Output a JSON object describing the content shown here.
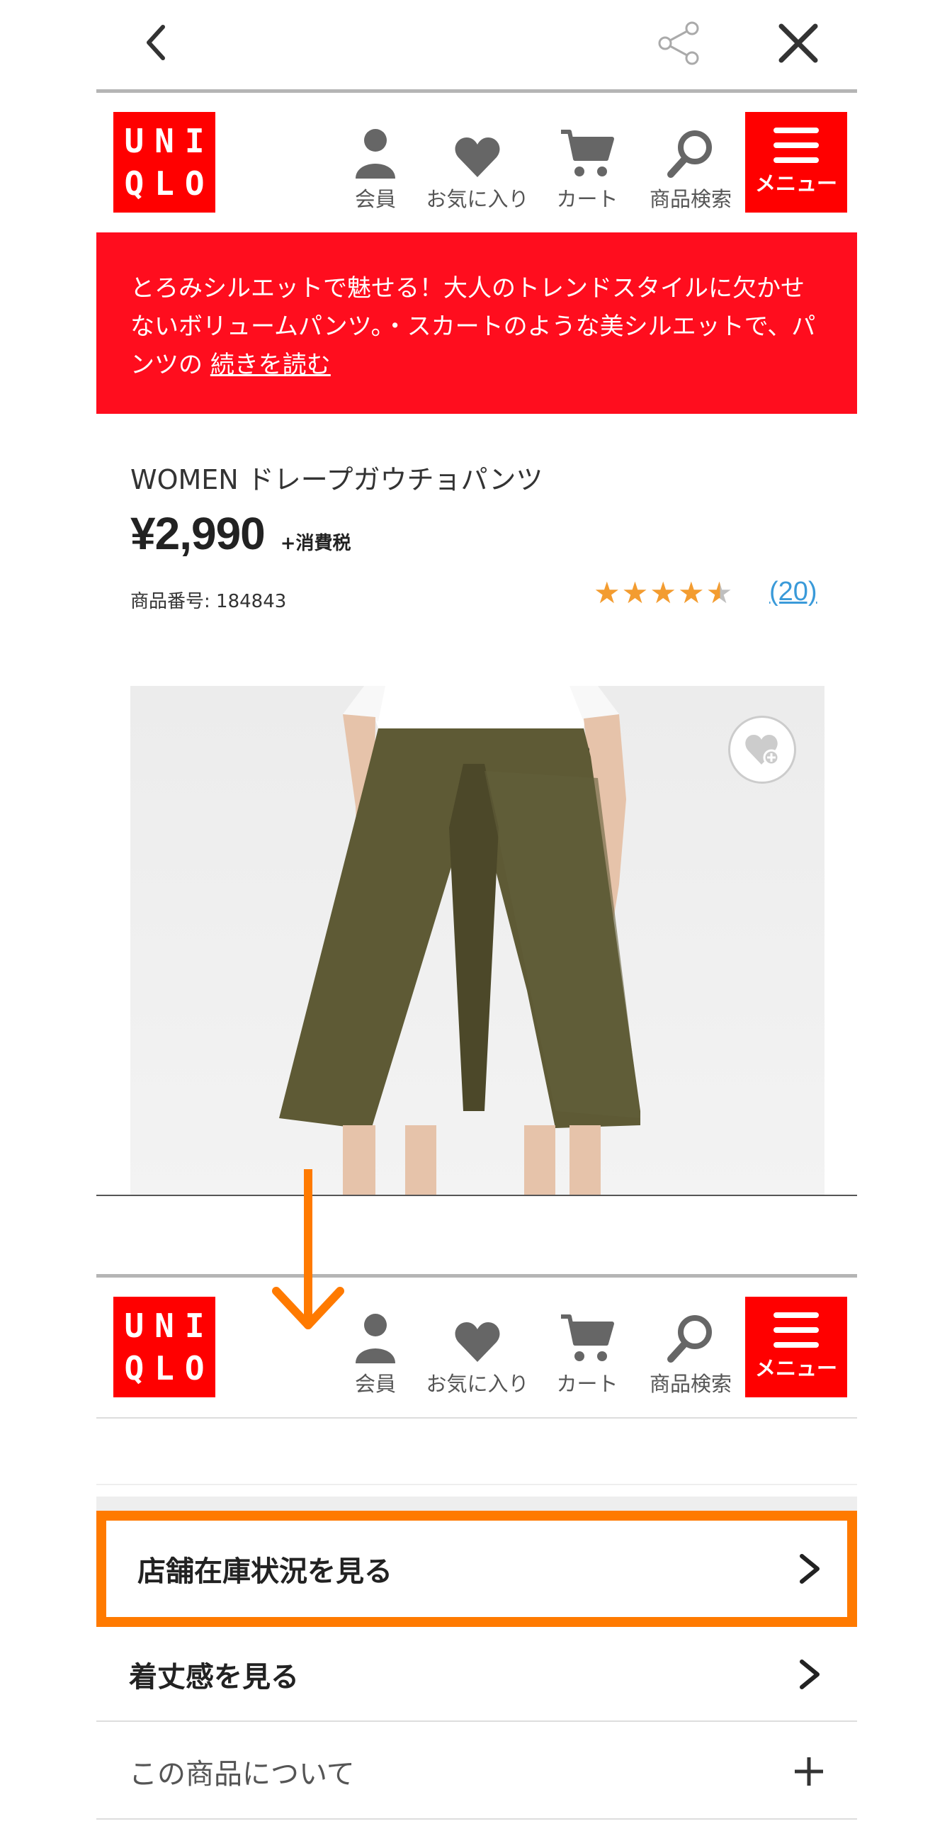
{
  "colors": {
    "brand_red": "#ff0000",
    "banner_red": "#ff0d1e",
    "accent_orange": "#ff7a00",
    "star_orange": "#f39c30",
    "link_blue": "#3a9ad9"
  },
  "topbar": {
    "back_icon": "chevron-left-icon",
    "share_icon": "share-icon",
    "close_icon": "close-icon"
  },
  "logo": {
    "letters": [
      "U",
      "N",
      "I",
      "Q",
      "L",
      "O"
    ]
  },
  "nav": {
    "member": "会員",
    "favorites": "お気に入り",
    "cart": "カート",
    "search": "商品検索",
    "menu": "メニュー"
  },
  "banner": {
    "text": "とろみシルエットで魅せる！大人のトレンドスタイルに欠かせないボリュームパンツ。・スカートのような美シルエットで、パンツの ",
    "read_more": "続きを読む"
  },
  "product": {
    "title": "WOMEN ドレープガウチョパンツ",
    "price": "¥2,990",
    "tax_note": "+消費税",
    "code": "商品番号: 184843",
    "rating": 4.5,
    "rating_max": 5,
    "review_count": "(20)"
  },
  "rows": {
    "store_stock": "店舗在庫状況を見る",
    "fit": "着丈感を見る",
    "about": "この商品について"
  }
}
